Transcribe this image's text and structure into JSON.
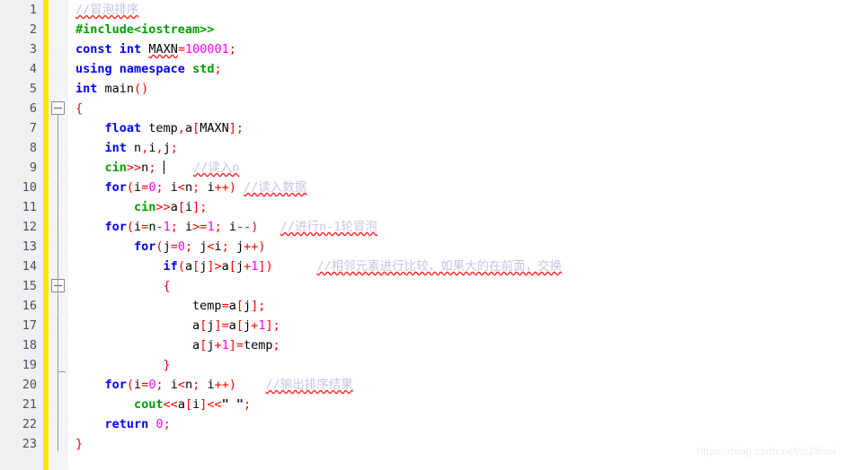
{
  "editor": {
    "name": "code-editor",
    "language": "C++",
    "total_lines": 23,
    "colors": {
      "keyword": "#0000ff",
      "preprocessor": "#00a000",
      "stream": "#00a000",
      "number": "#ff00ff",
      "operator": "#ff0000",
      "identifier": "#000000",
      "string": "#10104a",
      "comment": "#c6c6e6",
      "gutter_background": "#f0f0f0",
      "line_number": "#4a5068",
      "modified_bar": "#ffe800",
      "spellcheck_underline": "#ff2020",
      "editor_background": "#ffffff"
    }
  },
  "line_numbers": [
    "1",
    "2",
    "3",
    "4",
    "5",
    "6",
    "7",
    "8",
    "9",
    "10",
    "11",
    "12",
    "13",
    "14",
    "15",
    "16",
    "17",
    "18",
    "19",
    "20",
    "21",
    "22",
    "23"
  ],
  "fold_markers": [
    {
      "line": 6,
      "type": "collapse-box"
    },
    {
      "line": 15,
      "type": "collapse-box"
    },
    {
      "line": 19,
      "type": "fold-end-tick"
    }
  ],
  "code_lines": [
    {
      "n": 1,
      "tokens": [
        {
          "t": "//冒泡排序",
          "c": "cmt",
          "sq": true
        }
      ]
    },
    {
      "n": 2,
      "tokens": [
        {
          "t": "#include<iostream>>",
          "c": "pre"
        }
      ]
    },
    {
      "n": 3,
      "tokens": [
        {
          "t": "const",
          "c": "kw"
        },
        {
          "t": " ",
          "c": "id"
        },
        {
          "t": "int",
          "c": "kw"
        },
        {
          "t": " ",
          "c": "id"
        },
        {
          "t": "MAXN",
          "c": "id",
          "sq": true
        },
        {
          "t": "=",
          "c": "op"
        },
        {
          "t": "100001",
          "c": "num"
        },
        {
          "t": ";",
          "c": "op"
        }
      ]
    },
    {
      "n": 4,
      "tokens": [
        {
          "t": "using",
          "c": "kw"
        },
        {
          "t": " ",
          "c": "id"
        },
        {
          "t": "namespace",
          "c": "kw"
        },
        {
          "t": " ",
          "c": "id"
        },
        {
          "t": "std",
          "c": "strm"
        },
        {
          "t": ";",
          "c": "op"
        }
      ]
    },
    {
      "n": 5,
      "tokens": [
        {
          "t": "int",
          "c": "kw"
        },
        {
          "t": " ",
          "c": "id"
        },
        {
          "t": "main",
          "c": "id"
        },
        {
          "t": "()",
          "c": "op"
        }
      ]
    },
    {
      "n": 6,
      "tokens": [
        {
          "t": "{",
          "c": "op"
        }
      ]
    },
    {
      "n": 7,
      "tokens": [
        {
          "t": "    ",
          "c": "id"
        },
        {
          "t": "float",
          "c": "kw"
        },
        {
          "t": " ",
          "c": "id"
        },
        {
          "t": "temp",
          "c": "id"
        },
        {
          "t": ",",
          "c": "op"
        },
        {
          "t": "a",
          "c": "id"
        },
        {
          "t": "[",
          "c": "op"
        },
        {
          "t": "MAXN",
          "c": "id"
        },
        {
          "t": "]",
          "c": "op"
        },
        {
          "t": ";",
          "c": "op"
        }
      ]
    },
    {
      "n": 8,
      "tokens": [
        {
          "t": "    ",
          "c": "id"
        },
        {
          "t": "int",
          "c": "kw"
        },
        {
          "t": " ",
          "c": "id"
        },
        {
          "t": "n",
          "c": "id"
        },
        {
          "t": ",",
          "c": "op"
        },
        {
          "t": "i",
          "c": "id"
        },
        {
          "t": ",",
          "c": "op"
        },
        {
          "t": "j",
          "c": "id"
        },
        {
          "t": ";",
          "c": "op"
        }
      ]
    },
    {
      "n": 9,
      "tokens": [
        {
          "t": "    ",
          "c": "id"
        },
        {
          "t": "cin",
          "c": "strm"
        },
        {
          "t": ">>",
          "c": "op"
        },
        {
          "t": "n",
          "c": "id"
        },
        {
          "t": ";",
          "c": "op"
        },
        {
          "t": " ",
          "c": "id"
        },
        {
          "t": "|CARET|",
          "c": "caret"
        },
        {
          "t": "    ",
          "c": "id"
        },
        {
          "t": "//读入n",
          "c": "cmt",
          "sq": true
        }
      ]
    },
    {
      "n": 10,
      "tokens": [
        {
          "t": "    ",
          "c": "id"
        },
        {
          "t": "for",
          "c": "kw"
        },
        {
          "t": "(",
          "c": "op"
        },
        {
          "t": "i",
          "c": "id"
        },
        {
          "t": "=",
          "c": "op"
        },
        {
          "t": "0",
          "c": "num"
        },
        {
          "t": ";",
          "c": "op"
        },
        {
          "t": " ",
          "c": "id"
        },
        {
          "t": "i",
          "c": "id"
        },
        {
          "t": "<",
          "c": "op"
        },
        {
          "t": "n",
          "c": "id"
        },
        {
          "t": ";",
          "c": "op"
        },
        {
          "t": " ",
          "c": "id"
        },
        {
          "t": "i",
          "c": "id"
        },
        {
          "t": "++",
          "c": "op"
        },
        {
          "t": ")",
          "c": "op"
        },
        {
          "t": " ",
          "c": "id"
        },
        {
          "t": "//读入数据",
          "c": "cmt",
          "sq": true
        }
      ]
    },
    {
      "n": 11,
      "tokens": [
        {
          "t": "        ",
          "c": "id"
        },
        {
          "t": "cin",
          "c": "strm"
        },
        {
          "t": ">>",
          "c": "op"
        },
        {
          "t": "a",
          "c": "id"
        },
        {
          "t": "[",
          "c": "op"
        },
        {
          "t": "i",
          "c": "id"
        },
        {
          "t": "]",
          "c": "op"
        },
        {
          "t": ";",
          "c": "op"
        }
      ]
    },
    {
      "n": 12,
      "tokens": [
        {
          "t": "    ",
          "c": "id"
        },
        {
          "t": "for",
          "c": "kw"
        },
        {
          "t": "(",
          "c": "op"
        },
        {
          "t": "i",
          "c": "id"
        },
        {
          "t": "=",
          "c": "op"
        },
        {
          "t": "n",
          "c": "id"
        },
        {
          "t": "-",
          "c": "op"
        },
        {
          "t": "1",
          "c": "num"
        },
        {
          "t": ";",
          "c": "op"
        },
        {
          "t": " ",
          "c": "id"
        },
        {
          "t": "i",
          "c": "id"
        },
        {
          "t": ">=",
          "c": "op"
        },
        {
          "t": "1",
          "c": "num"
        },
        {
          "t": ";",
          "c": "op"
        },
        {
          "t": " ",
          "c": "id"
        },
        {
          "t": "i",
          "c": "id"
        },
        {
          "t": "--",
          "c": "op"
        },
        {
          "t": ")",
          "c": "op"
        },
        {
          "t": "   ",
          "c": "id"
        },
        {
          "t": "//进行n-1轮冒泡",
          "c": "cmt",
          "sq": true
        }
      ]
    },
    {
      "n": 13,
      "tokens": [
        {
          "t": "        ",
          "c": "id"
        },
        {
          "t": "for",
          "c": "kw"
        },
        {
          "t": "(",
          "c": "op"
        },
        {
          "t": "j",
          "c": "id"
        },
        {
          "t": "=",
          "c": "op"
        },
        {
          "t": "0",
          "c": "num"
        },
        {
          "t": ";",
          "c": "op"
        },
        {
          "t": " ",
          "c": "id"
        },
        {
          "t": "j",
          "c": "id"
        },
        {
          "t": "<",
          "c": "op"
        },
        {
          "t": "i",
          "c": "id"
        },
        {
          "t": ";",
          "c": "op"
        },
        {
          "t": " ",
          "c": "id"
        },
        {
          "t": "j",
          "c": "id"
        },
        {
          "t": "++",
          "c": "op"
        },
        {
          "t": ")",
          "c": "op"
        }
      ]
    },
    {
      "n": 14,
      "tokens": [
        {
          "t": "            ",
          "c": "id"
        },
        {
          "t": "if",
          "c": "kw"
        },
        {
          "t": "(",
          "c": "op"
        },
        {
          "t": "a",
          "c": "id"
        },
        {
          "t": "[",
          "c": "op"
        },
        {
          "t": "j",
          "c": "id"
        },
        {
          "t": "]",
          "c": "op"
        },
        {
          "t": ">",
          "c": "op"
        },
        {
          "t": "a",
          "c": "id"
        },
        {
          "t": "[",
          "c": "op"
        },
        {
          "t": "j",
          "c": "id"
        },
        {
          "t": "+",
          "c": "op"
        },
        {
          "t": "1",
          "c": "num"
        },
        {
          "t": "]",
          "c": "op"
        },
        {
          "t": ")",
          "c": "op"
        },
        {
          "t": "      ",
          "c": "id"
        },
        {
          "t": "//相邻元素进行比较，如果大的在前面，交换",
          "c": "cmt",
          "sq": true
        }
      ]
    },
    {
      "n": 15,
      "tokens": [
        {
          "t": "            ",
          "c": "id"
        },
        {
          "t": "{",
          "c": "op"
        }
      ]
    },
    {
      "n": 16,
      "tokens": [
        {
          "t": "                ",
          "c": "id"
        },
        {
          "t": "temp",
          "c": "id"
        },
        {
          "t": "=",
          "c": "op"
        },
        {
          "t": "a",
          "c": "id"
        },
        {
          "t": "[",
          "c": "op"
        },
        {
          "t": "j",
          "c": "id"
        },
        {
          "t": "]",
          "c": "op"
        },
        {
          "t": ";",
          "c": "op"
        }
      ]
    },
    {
      "n": 17,
      "tokens": [
        {
          "t": "                ",
          "c": "id"
        },
        {
          "t": "a",
          "c": "id"
        },
        {
          "t": "[",
          "c": "op"
        },
        {
          "t": "j",
          "c": "id"
        },
        {
          "t": "]",
          "c": "op"
        },
        {
          "t": "=",
          "c": "op"
        },
        {
          "t": "a",
          "c": "id"
        },
        {
          "t": "[",
          "c": "op"
        },
        {
          "t": "j",
          "c": "id"
        },
        {
          "t": "+",
          "c": "op"
        },
        {
          "t": "1",
          "c": "num"
        },
        {
          "t": "]",
          "c": "op"
        },
        {
          "t": ";",
          "c": "op"
        }
      ]
    },
    {
      "n": 18,
      "tokens": [
        {
          "t": "                ",
          "c": "id"
        },
        {
          "t": "a",
          "c": "id"
        },
        {
          "t": "[",
          "c": "op"
        },
        {
          "t": "j",
          "c": "id"
        },
        {
          "t": "+",
          "c": "op"
        },
        {
          "t": "1",
          "c": "num"
        },
        {
          "t": "]",
          "c": "op"
        },
        {
          "t": "=",
          "c": "op"
        },
        {
          "t": "temp",
          "c": "id"
        },
        {
          "t": ";",
          "c": "op"
        }
      ]
    },
    {
      "n": 19,
      "tokens": [
        {
          "t": "            ",
          "c": "id"
        },
        {
          "t": "}",
          "c": "op"
        }
      ]
    },
    {
      "n": 20,
      "tokens": [
        {
          "t": "    ",
          "c": "id"
        },
        {
          "t": "for",
          "c": "kw"
        },
        {
          "t": "(",
          "c": "op"
        },
        {
          "t": "i",
          "c": "id"
        },
        {
          "t": "=",
          "c": "op"
        },
        {
          "t": "0",
          "c": "num"
        },
        {
          "t": ";",
          "c": "op"
        },
        {
          "t": " ",
          "c": "id"
        },
        {
          "t": "i",
          "c": "id"
        },
        {
          "t": "<",
          "c": "op"
        },
        {
          "t": "n",
          "c": "id"
        },
        {
          "t": ";",
          "c": "op"
        },
        {
          "t": " ",
          "c": "id"
        },
        {
          "t": "i",
          "c": "id"
        },
        {
          "t": "++",
          "c": "op"
        },
        {
          "t": ")",
          "c": "op"
        },
        {
          "t": "    ",
          "c": "id"
        },
        {
          "t": "//输出排序结果",
          "c": "cmt",
          "sq": true
        }
      ]
    },
    {
      "n": 21,
      "tokens": [
        {
          "t": "        ",
          "c": "id"
        },
        {
          "t": "cout",
          "c": "strm"
        },
        {
          "t": "<<",
          "c": "op"
        },
        {
          "t": "a",
          "c": "id"
        },
        {
          "t": "[",
          "c": "op"
        },
        {
          "t": "i",
          "c": "id"
        },
        {
          "t": "]",
          "c": "op"
        },
        {
          "t": "<<",
          "c": "op"
        },
        {
          "t": "\" \"",
          "c": "str"
        },
        {
          "t": ";",
          "c": "op"
        }
      ]
    },
    {
      "n": 22,
      "tokens": [
        {
          "t": "    ",
          "c": "id"
        },
        {
          "t": "return",
          "c": "kw"
        },
        {
          "t": " ",
          "c": "id"
        },
        {
          "t": "0",
          "c": "num"
        },
        {
          "t": ";",
          "c": "op"
        }
      ]
    },
    {
      "n": 23,
      "tokens": [
        {
          "t": "}",
          "c": "op"
        }
      ]
    }
  ],
  "watermark": {
    "text": "https://blog.csdn.net/lz28noi"
  }
}
